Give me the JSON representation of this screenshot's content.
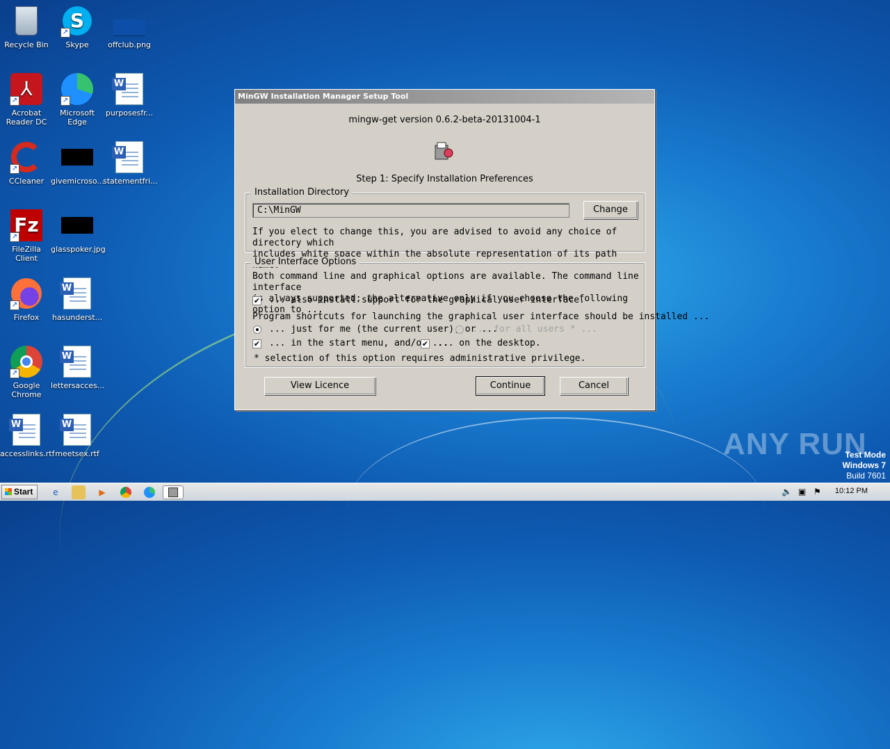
{
  "desktop": {
    "icons": [
      {
        "label": "Recycle Bin",
        "icon": "recycle-bin-icon"
      },
      {
        "label": "Skype",
        "icon": "skype-icon"
      },
      {
        "label": "offclub.png",
        "icon": "image-file-icon"
      },
      {
        "label": "Acrobat Reader DC",
        "icon": "acrobat-icon"
      },
      {
        "label": "Microsoft Edge",
        "icon": "edge-icon"
      },
      {
        "label": "purposesfr...",
        "icon": "word-doc-icon"
      },
      {
        "label": "CCleaner",
        "icon": "ccleaner-icon"
      },
      {
        "label": "givemicroso...",
        "icon": "image-file-icon"
      },
      {
        "label": "statementfri...",
        "icon": "word-doc-icon"
      },
      {
        "label": "FileZilla Client",
        "icon": "filezilla-icon"
      },
      {
        "label": "glasspoker.jpg",
        "icon": "image-file-icon"
      },
      {
        "label": "Firefox",
        "icon": "firefox-icon"
      },
      {
        "label": "hasunderst...",
        "icon": "word-doc-icon"
      },
      {
        "label": "Google Chrome",
        "icon": "chrome-icon"
      },
      {
        "label": "lettersacces...",
        "icon": "word-doc-icon"
      },
      {
        "label": "accesslinks.rtf",
        "icon": "word-doc-icon"
      },
      {
        "label": "meetsex.rtf",
        "icon": "word-doc-icon"
      }
    ]
  },
  "dialog": {
    "title": "MinGW Installation Manager Setup Tool",
    "version": "mingw-get version 0.6.2-beta-20131004-1",
    "step": "Step 1: Specify Installation Preferences",
    "install_dir": {
      "legend": "Installation Directory",
      "value": "C:\\MinGW",
      "change_label": "Change",
      "note_line1": "If you elect to change this, you are advised to avoid any choice of directory which",
      "note_line2": "includes white space within the absolute representation of its path name."
    },
    "ui_options": {
      "legend": "User Interface Options",
      "intro_line1": "Both command line and graphical options are available.  The command line interface",
      "intro_line2": "is always supported; the alternative only if you choose the following option to ...",
      "gui_support_label": "... also install support for the graphical user interface.",
      "gui_support_checked": true,
      "shortcuts_intro": "Program shortcuts for launching the graphical user interface should be installed ...",
      "just_me_label": "... just for me (the current user), or ...",
      "just_me_selected": true,
      "all_users_label": "... for all users * ...",
      "start_menu_label": "... in the start menu, and/or ...",
      "start_menu_checked": true,
      "desktop_label": "... on the desktop.",
      "desktop_checked": true,
      "footnote": "*  selection of this option requires administrative privilege."
    },
    "buttons": {
      "view_licence": "View Licence",
      "continue": "Continue",
      "cancel": "Cancel"
    }
  },
  "watermark": "ANY RUN",
  "test_mode": {
    "line1": "Test Mode",
    "line2": "Windows 7",
    "line3": "Build 7601"
  },
  "taskbar": {
    "start_label": "Start",
    "clock": "10:12 PM"
  }
}
